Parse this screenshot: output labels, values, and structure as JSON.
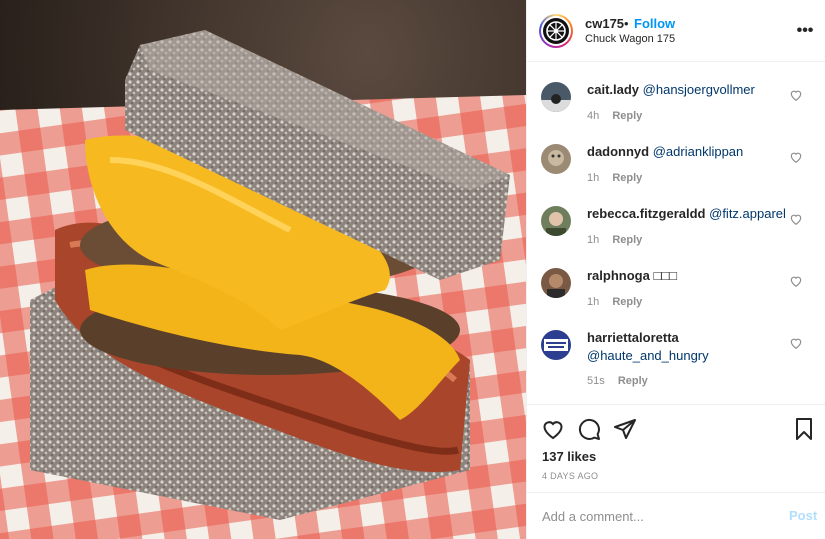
{
  "header": {
    "username": "cw175",
    "separator": "•",
    "follow_label": "Follow",
    "subtitle": "Chuck Wagon 175",
    "more_glyph": "•••"
  },
  "photo": {
    "subject": "burger-with-lamington-buns"
  },
  "comments": [
    {
      "username": "cait.lady",
      "mention": "@hansjoergvollmer",
      "time": "4h",
      "reply_label": "Reply",
      "avatar_color": "#4a5968"
    },
    {
      "username": "dadonnyd",
      "mention": "@adrianklippan",
      "time": "1h",
      "reply_label": "Reply",
      "avatar_color": "#9b8a74"
    },
    {
      "username": "rebecca.fitzgeraldd",
      "mention": "@fitz.apparel",
      "time": "1h",
      "reply_label": "Reply",
      "avatar_color": "#6f7f5e"
    },
    {
      "username": "ralphnoga",
      "mention": "□□□",
      "time": "1h",
      "reply_label": "Reply",
      "avatar_color": "#7a5a44"
    },
    {
      "username": "harriettaloretta",
      "mention": "@haute_and_hungry",
      "time": "51s",
      "reply_label": "Reply",
      "avatar_color": "#2c3e8f"
    }
  ],
  "actions": {
    "likes_text": "137 likes",
    "date_text": "4 DAYS AGO"
  },
  "add_comment": {
    "placeholder": "Add a comment...",
    "post_label": "Post"
  },
  "colors": {
    "link_blue": "#0095f6",
    "mention_blue": "#00376b",
    "muted": "#8e8e8e",
    "post_disabled": "#b2dffc"
  },
  "icons": [
    "more-options-icon",
    "heart-icon",
    "comment-icon",
    "share-icon",
    "bookmark-icon"
  ]
}
